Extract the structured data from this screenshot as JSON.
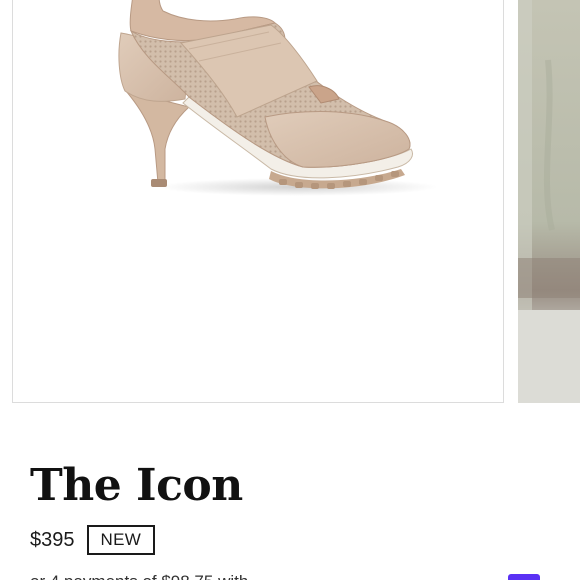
{
  "product": {
    "title": "The Icon",
    "price": "$395",
    "condition_badge": "NEW"
  },
  "installments": {
    "partial_text": "or 4 payments of $98.75 with"
  },
  "colors": {
    "text": "#111111",
    "shoe_suede": "#d8c1ae",
    "shoe_mesh": "#cbb6a3",
    "sole_white": "#f3efe8",
    "accent_purple": "#5a31f4"
  },
  "icons": {
    "pay_logo": "shop-pay-icon"
  }
}
